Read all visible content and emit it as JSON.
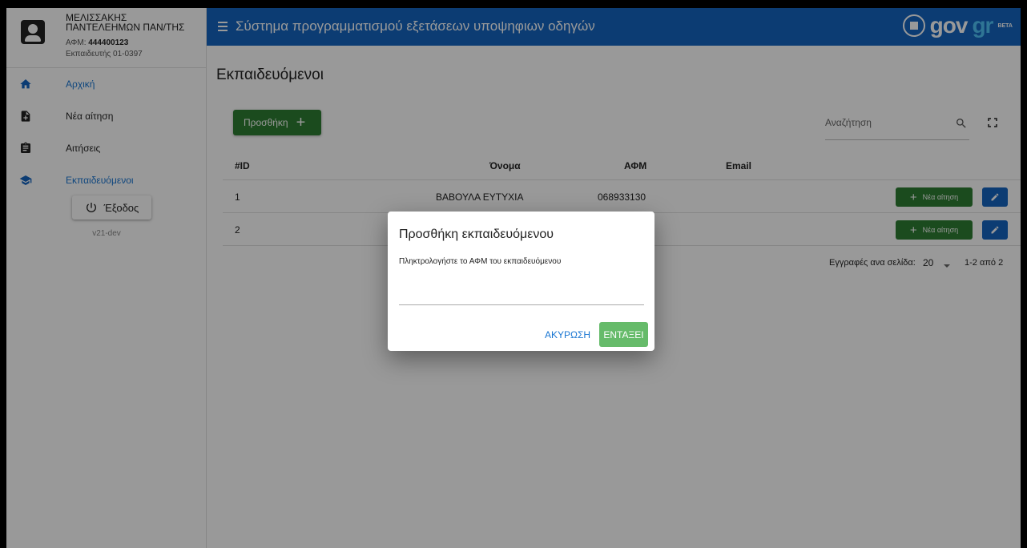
{
  "profile": {
    "name": "ΜΕΛΙΣΣΑΚΗΣ ΠΑΝΤΕΛΕΗΜΩΝ ΠΑΝ/ΤΗΣ",
    "afm_label": "ΑΦΜ:",
    "afm_value": "444400123",
    "trainer": "Εκπαιδευτής 01-0397"
  },
  "sidebar": {
    "items": [
      {
        "label": "Αρχική",
        "icon": "home-icon"
      },
      {
        "label": "Νέα αίτηση",
        "icon": "new-file-icon"
      },
      {
        "label": "Αιτήσεις",
        "icon": "clipboard-icon"
      },
      {
        "label": "Εκπαιδευόμενοι",
        "icon": "school-icon"
      }
    ],
    "logout_label": "Έξοδος",
    "version": "v21-dev"
  },
  "header": {
    "title": "Σύστημα προγραμματισμού εξετάσεων υποψηφιων οδηγών",
    "logo_gov": "gov",
    "logo_gr": "gr",
    "logo_beta": "BETA"
  },
  "main": {
    "page_title": "Εκπαιδευόμενοι",
    "add_button_label": "Προσθήκη",
    "search_placeholder": "Αναζήτηση",
    "table": {
      "columns": [
        "#ID",
        "Όνομα",
        "ΑΦΜ",
        "Email"
      ],
      "rows": [
        {
          "id": "1",
          "name": "ΒΑΒΟΥΛΑ ΕΥΤΥΧΙΑ",
          "afm": "068933130",
          "email": ""
        },
        {
          "id": "2",
          "name": "",
          "afm": "",
          "email": ""
        }
      ],
      "row_action_label": "Νέα αίτηση"
    },
    "pagination": {
      "rows_per_page_label": "Εγγραφές ανα σελίδα:",
      "rows_per_page": "20",
      "range": "1-2 από 2"
    }
  },
  "dialog": {
    "title": "Προσθήκη εκπαιδευόμενου",
    "text": "Πληκτρολογήστε το ΑΦΜ του εκπαιδευόμενου",
    "input_value": "",
    "cancel_label": "ΑΚΥΡΩΣΗ",
    "ok_label": "ΕΝΤΑΞΕΙ"
  },
  "colors": {
    "primary": "#1565c0",
    "success": "#2e7d32",
    "success_light": "#66bb6a",
    "link": "#1976d2"
  }
}
